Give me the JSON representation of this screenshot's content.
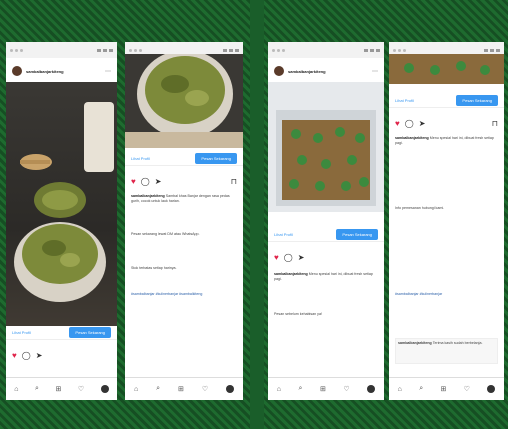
{
  "screens": [
    {
      "handle": "sambalbanjarkiteng",
      "cta_label": "Lihat Profil",
      "cta_button": "Pesan Sekarang"
    },
    {
      "cta_label": "Lihat Profil",
      "cta_button": "Pesan Sekarang",
      "caption_user": "sambalbanjarkiteng",
      "caption_text": "Sambal khas Banjar dengan rasa pedas gurih, cocok untuk lauk harian.",
      "caption_text2": "Pesan sekarang lewat DM atau WhatsApp.",
      "caption_text3": "Stok terbatas setiap harinya.",
      "tags": "#sambalbanjar #kulinerbanjar #sambalkiteng"
    },
    {
      "handle": "sambalbanjarkiteng",
      "cta_label": "Lihat Profil",
      "cta_button": "Pesan Sekarang",
      "caption_user": "sambalbanjarkiteng",
      "caption_text": "Menu spesial hari ini, dibuat fresh setiap pagi.",
      "caption_text2": "Pesan sebelum kehabisan ya!"
    },
    {
      "cta_label": "Lihat Profil",
      "cta_button": "Pesan Sekarang",
      "caption_user": "sambalbanjarkiteng",
      "caption_text": "Menu spesial hari ini, dibuat fresh setiap pagi.",
      "caption_text2": "Info pemesanan hubungi kami.",
      "tags": "#sambalbanjar #kulinerbanjar",
      "comment_user": "sambalbanjarkiteng",
      "comment_text": "Terima kasih sudah berbelanja."
    }
  ]
}
